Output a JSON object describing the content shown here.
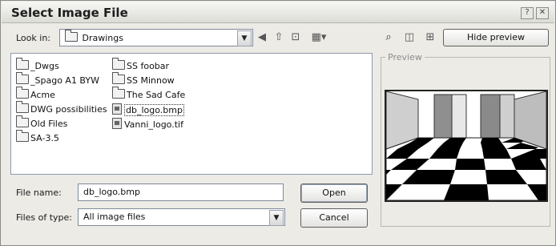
{
  "dialog": {
    "title": "Select Image File"
  },
  "window_controls": {
    "help": "?",
    "close": "✕"
  },
  "look_in": {
    "label": "Look in:",
    "value": "Drawings"
  },
  "toolbar": {
    "hide_preview_label": "Hide preview"
  },
  "files": {
    "col1": [
      "_Dwgs",
      "_Spago A1 BYW",
      "Acme",
      "DWG possibilities",
      "Old Files",
      "SA-3.5"
    ],
    "col2": [
      {
        "name": "SS foobar",
        "type": "folder"
      },
      {
        "name": "SS Minnow",
        "type": "folder"
      },
      {
        "name": "The Sad Cafe",
        "type": "folder"
      },
      {
        "name": "db_logo.bmp",
        "type": "file",
        "selected": true
      },
      {
        "name": "Vanni_logo.tif",
        "type": "file"
      }
    ]
  },
  "file_name": {
    "label": "File name:",
    "value": "db_logo.bmp"
  },
  "files_of_type": {
    "label": "Files of type:",
    "value": "All image files"
  },
  "buttons": {
    "open": "Open",
    "cancel": "Cancel"
  },
  "preview": {
    "label": "Preview"
  },
  "colors": {
    "dialog_bg": "#ecebe6",
    "list_border": "#8f99a8"
  },
  "icons": [
    "folder-icon",
    "back-icon",
    "up-folder-icon",
    "new-folder-icon",
    "views-menu-icon",
    "find-icon",
    "locate-icon",
    "extract-icon"
  ]
}
